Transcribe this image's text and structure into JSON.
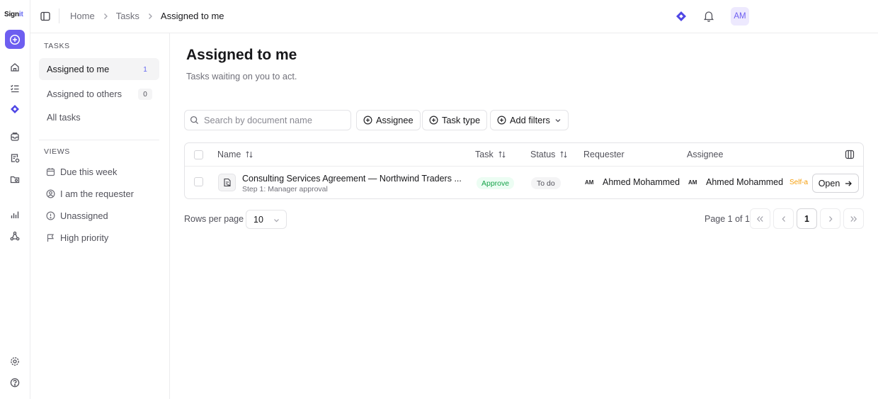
{
  "app": {
    "logo_text": "Sign",
    "logo_accent": "it"
  },
  "header": {
    "breadcrumb": [
      "Home",
      "Tasks",
      "Assigned to me"
    ],
    "avatar_initials": "AM"
  },
  "sidebar": {
    "tasks_label": "TASKS",
    "tasks": [
      {
        "label": "Assigned to me",
        "count": "1"
      },
      {
        "label": "Assigned to others",
        "count": "0"
      },
      {
        "label": "All tasks"
      }
    ],
    "views_label": "VIEWS",
    "views": [
      {
        "label": "Due this week",
        "icon": "calendar-icon"
      },
      {
        "label": "I am the requester",
        "icon": "user-circle-icon"
      },
      {
        "label": "Unassigned",
        "icon": "alert-circle-icon"
      },
      {
        "label": "High priority",
        "icon": "flag-icon"
      }
    ]
  },
  "page": {
    "title": "Assigned to me",
    "subtitle": "Tasks waiting on you to act."
  },
  "filters": {
    "search_placeholder": "Search by document name",
    "assignee": "Assignee",
    "task_type": "Task type",
    "add_filters": "Add filters"
  },
  "table": {
    "columns": {
      "name": "Name",
      "task": "Task",
      "status": "Status",
      "requester": "Requester",
      "assignee": "Assignee"
    },
    "rows": [
      {
        "name": "Consulting Services Agreement — Northwind Traders ...",
        "step": "Step 1: Manager approval",
        "task": "Approve",
        "status": "To do",
        "requester_initials": "AM",
        "requester": "Ahmed Mohammed",
        "assignee_initials": "AM",
        "assignee": "Ahmed Mohammed",
        "assignee_tag": "Self-a",
        "action": "Open"
      }
    ]
  },
  "pagination": {
    "rows_per_page_label": "Rows per page",
    "rows_per_page": "10",
    "page_info": "Page 1 of 1",
    "current_page": "1"
  },
  "colors": {
    "accent": "#6d5ef0",
    "approve": "#16a34a",
    "self_tag": "#f59e0b"
  }
}
